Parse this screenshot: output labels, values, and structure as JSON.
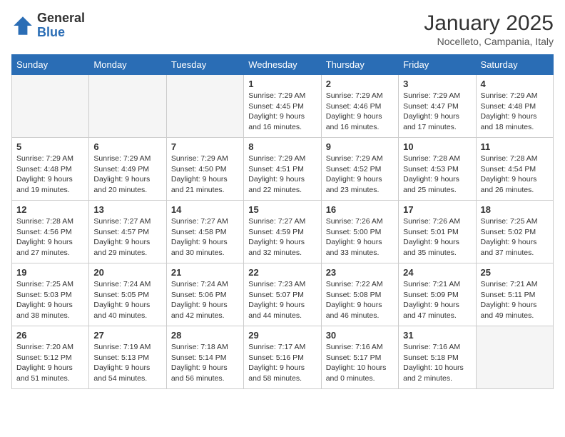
{
  "header": {
    "logo_general": "General",
    "logo_blue": "Blue",
    "title": "January 2025",
    "location": "Nocelleto, Campania, Italy"
  },
  "weekdays": [
    "Sunday",
    "Monday",
    "Tuesday",
    "Wednesday",
    "Thursday",
    "Friday",
    "Saturday"
  ],
  "weeks": [
    [
      {
        "day": "",
        "info": "",
        "empty": true
      },
      {
        "day": "",
        "info": "",
        "empty": true
      },
      {
        "day": "",
        "info": "",
        "empty": true
      },
      {
        "day": "1",
        "info": "Sunrise: 7:29 AM\nSunset: 4:45 PM\nDaylight: 9 hours\nand 16 minutes."
      },
      {
        "day": "2",
        "info": "Sunrise: 7:29 AM\nSunset: 4:46 PM\nDaylight: 9 hours\nand 16 minutes."
      },
      {
        "day": "3",
        "info": "Sunrise: 7:29 AM\nSunset: 4:47 PM\nDaylight: 9 hours\nand 17 minutes."
      },
      {
        "day": "4",
        "info": "Sunrise: 7:29 AM\nSunset: 4:48 PM\nDaylight: 9 hours\nand 18 minutes."
      }
    ],
    [
      {
        "day": "5",
        "info": "Sunrise: 7:29 AM\nSunset: 4:48 PM\nDaylight: 9 hours\nand 19 minutes."
      },
      {
        "day": "6",
        "info": "Sunrise: 7:29 AM\nSunset: 4:49 PM\nDaylight: 9 hours\nand 20 minutes."
      },
      {
        "day": "7",
        "info": "Sunrise: 7:29 AM\nSunset: 4:50 PM\nDaylight: 9 hours\nand 21 minutes."
      },
      {
        "day": "8",
        "info": "Sunrise: 7:29 AM\nSunset: 4:51 PM\nDaylight: 9 hours\nand 22 minutes."
      },
      {
        "day": "9",
        "info": "Sunrise: 7:29 AM\nSunset: 4:52 PM\nDaylight: 9 hours\nand 23 minutes."
      },
      {
        "day": "10",
        "info": "Sunrise: 7:28 AM\nSunset: 4:53 PM\nDaylight: 9 hours\nand 25 minutes."
      },
      {
        "day": "11",
        "info": "Sunrise: 7:28 AM\nSunset: 4:54 PM\nDaylight: 9 hours\nand 26 minutes."
      }
    ],
    [
      {
        "day": "12",
        "info": "Sunrise: 7:28 AM\nSunset: 4:56 PM\nDaylight: 9 hours\nand 27 minutes."
      },
      {
        "day": "13",
        "info": "Sunrise: 7:27 AM\nSunset: 4:57 PM\nDaylight: 9 hours\nand 29 minutes."
      },
      {
        "day": "14",
        "info": "Sunrise: 7:27 AM\nSunset: 4:58 PM\nDaylight: 9 hours\nand 30 minutes."
      },
      {
        "day": "15",
        "info": "Sunrise: 7:27 AM\nSunset: 4:59 PM\nDaylight: 9 hours\nand 32 minutes."
      },
      {
        "day": "16",
        "info": "Sunrise: 7:26 AM\nSunset: 5:00 PM\nDaylight: 9 hours\nand 33 minutes."
      },
      {
        "day": "17",
        "info": "Sunrise: 7:26 AM\nSunset: 5:01 PM\nDaylight: 9 hours\nand 35 minutes."
      },
      {
        "day": "18",
        "info": "Sunrise: 7:25 AM\nSunset: 5:02 PM\nDaylight: 9 hours\nand 37 minutes."
      }
    ],
    [
      {
        "day": "19",
        "info": "Sunrise: 7:25 AM\nSunset: 5:03 PM\nDaylight: 9 hours\nand 38 minutes."
      },
      {
        "day": "20",
        "info": "Sunrise: 7:24 AM\nSunset: 5:05 PM\nDaylight: 9 hours\nand 40 minutes."
      },
      {
        "day": "21",
        "info": "Sunrise: 7:24 AM\nSunset: 5:06 PM\nDaylight: 9 hours\nand 42 minutes."
      },
      {
        "day": "22",
        "info": "Sunrise: 7:23 AM\nSunset: 5:07 PM\nDaylight: 9 hours\nand 44 minutes."
      },
      {
        "day": "23",
        "info": "Sunrise: 7:22 AM\nSunset: 5:08 PM\nDaylight: 9 hours\nand 46 minutes."
      },
      {
        "day": "24",
        "info": "Sunrise: 7:21 AM\nSunset: 5:09 PM\nDaylight: 9 hours\nand 47 minutes."
      },
      {
        "day": "25",
        "info": "Sunrise: 7:21 AM\nSunset: 5:11 PM\nDaylight: 9 hours\nand 49 minutes."
      }
    ],
    [
      {
        "day": "26",
        "info": "Sunrise: 7:20 AM\nSunset: 5:12 PM\nDaylight: 9 hours\nand 51 minutes."
      },
      {
        "day": "27",
        "info": "Sunrise: 7:19 AM\nSunset: 5:13 PM\nDaylight: 9 hours\nand 54 minutes."
      },
      {
        "day": "28",
        "info": "Sunrise: 7:18 AM\nSunset: 5:14 PM\nDaylight: 9 hours\nand 56 minutes."
      },
      {
        "day": "29",
        "info": "Sunrise: 7:17 AM\nSunset: 5:16 PM\nDaylight: 9 hours\nand 58 minutes."
      },
      {
        "day": "30",
        "info": "Sunrise: 7:16 AM\nSunset: 5:17 PM\nDaylight: 10 hours\nand 0 minutes."
      },
      {
        "day": "31",
        "info": "Sunrise: 7:16 AM\nSunset: 5:18 PM\nDaylight: 10 hours\nand 2 minutes."
      },
      {
        "day": "",
        "info": "",
        "empty": true
      }
    ]
  ]
}
